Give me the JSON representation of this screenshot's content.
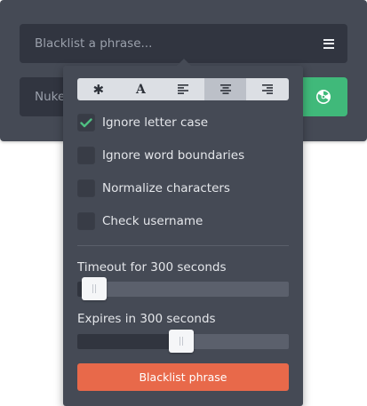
{
  "phrase_input": {
    "placeholder": "Blacklist a phrase..."
  },
  "nuke_input": {
    "placeholder": "Nuke"
  },
  "nuke_button": {
    "icon": "radiation-icon",
    "color": "#40b97a"
  },
  "menu_button": {
    "icon": "hamburger-menu-icon"
  },
  "match_modes": [
    {
      "glyph": "✱",
      "icon": "asterisk-icon",
      "active": false
    },
    {
      "glyph": "A",
      "icon": "font-icon",
      "active": false
    },
    {
      "glyph": "",
      "icon": "align-left-icon",
      "active": false
    },
    {
      "glyph": "",
      "icon": "align-center-icon",
      "active": true
    },
    {
      "glyph": "",
      "icon": "align-right-icon",
      "active": false
    }
  ],
  "options": [
    {
      "label": "Ignore letter case",
      "checked": true
    },
    {
      "label": "Ignore word boundaries",
      "checked": false
    },
    {
      "label": "Normalize characters",
      "checked": false
    },
    {
      "label": "Check username",
      "checked": false
    }
  ],
  "timeout": {
    "label": "Timeout for 300 seconds",
    "level": 0.08
  },
  "expires": {
    "label": "Expires in 300 seconds",
    "level": 0.49
  },
  "submit_label": "Blacklist phrase",
  "colors": {
    "accent_green": "#40b97a",
    "submit": "#e8694a",
    "check": "#4fbf82"
  }
}
